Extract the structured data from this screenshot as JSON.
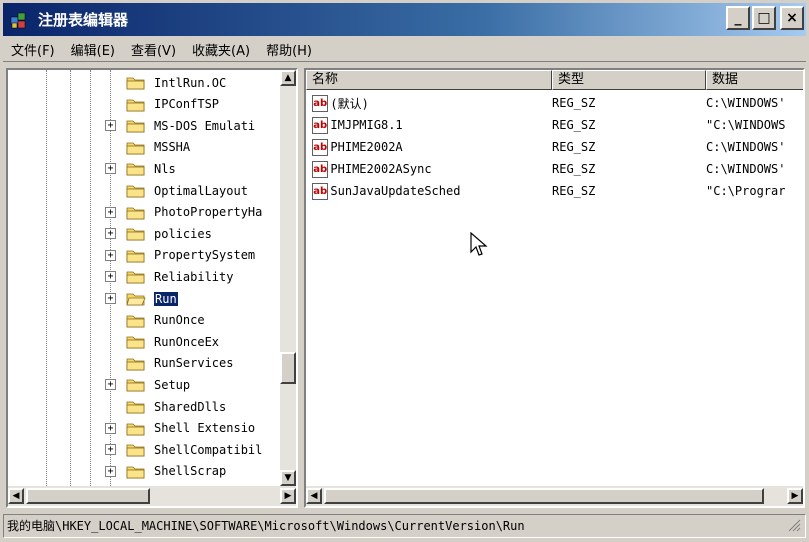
{
  "window": {
    "title": "注册表编辑器",
    "controls": {
      "minimize": "_",
      "maximize": "□",
      "close": "×"
    }
  },
  "menu": [
    "文件(F)",
    "编辑(E)",
    "查看(V)",
    "收藏夹(A)",
    "帮助(H)"
  ],
  "tree": {
    "items": [
      {
        "label": "IntlRun.OC",
        "expandable": false,
        "selected": false
      },
      {
        "label": "IPConfTSP",
        "expandable": false,
        "selected": false
      },
      {
        "label": "MS-DOS Emulati",
        "expandable": true,
        "selected": false
      },
      {
        "label": "MSSHA",
        "expandable": false,
        "selected": false
      },
      {
        "label": "Nls",
        "expandable": true,
        "selected": false
      },
      {
        "label": "OptimalLayout",
        "expandable": false,
        "selected": false
      },
      {
        "label": "PhotoPropertyHa",
        "expandable": true,
        "selected": false
      },
      {
        "label": "policies",
        "expandable": true,
        "selected": false
      },
      {
        "label": "PropertySystem",
        "expandable": true,
        "selected": false
      },
      {
        "label": "Reliability",
        "expandable": true,
        "selected": false
      },
      {
        "label": "Run",
        "expandable": true,
        "selected": true
      },
      {
        "label": "RunOnce",
        "expandable": false,
        "selected": false
      },
      {
        "label": "RunOnceEx",
        "expandable": false,
        "selected": false
      },
      {
        "label": "RunServices",
        "expandable": false,
        "selected": false
      },
      {
        "label": "Setup",
        "expandable": true,
        "selected": false
      },
      {
        "label": "SharedDlls",
        "expandable": false,
        "selected": false
      },
      {
        "label": "Shell Extensio",
        "expandable": true,
        "selected": false
      },
      {
        "label": "ShellCompatibil",
        "expandable": true,
        "selected": false
      },
      {
        "label": "ShellScrap",
        "expandable": true,
        "selected": false
      }
    ]
  },
  "list": {
    "columns": [
      "名称",
      "类型",
      "数据"
    ],
    "rows": [
      {
        "name": "(默认)",
        "type": "REG_SZ",
        "data": "C:\\WINDOWS'"
      },
      {
        "name": "IMJPMIG8.1",
        "type": "REG_SZ",
        "data": "\"C:\\WINDOWS"
      },
      {
        "name": "PHIME2002A",
        "type": "REG_SZ",
        "data": "C:\\WINDOWS'"
      },
      {
        "name": "PHIME2002ASync",
        "type": "REG_SZ",
        "data": "C:\\WINDOWS'"
      },
      {
        "name": "SunJavaUpdateSched",
        "type": "REG_SZ",
        "data": "\"C:\\Prograr"
      }
    ],
    "icon_text": "ab"
  },
  "status": {
    "path": "我的电脑\\HKEY_LOCAL_MACHINE\\SOFTWARE\\Microsoft\\Windows\\CurrentVersion\\Run"
  },
  "colors": {
    "titlebar": "#0a246a",
    "selection": "#0a246a",
    "folder": "#f5d86a"
  }
}
